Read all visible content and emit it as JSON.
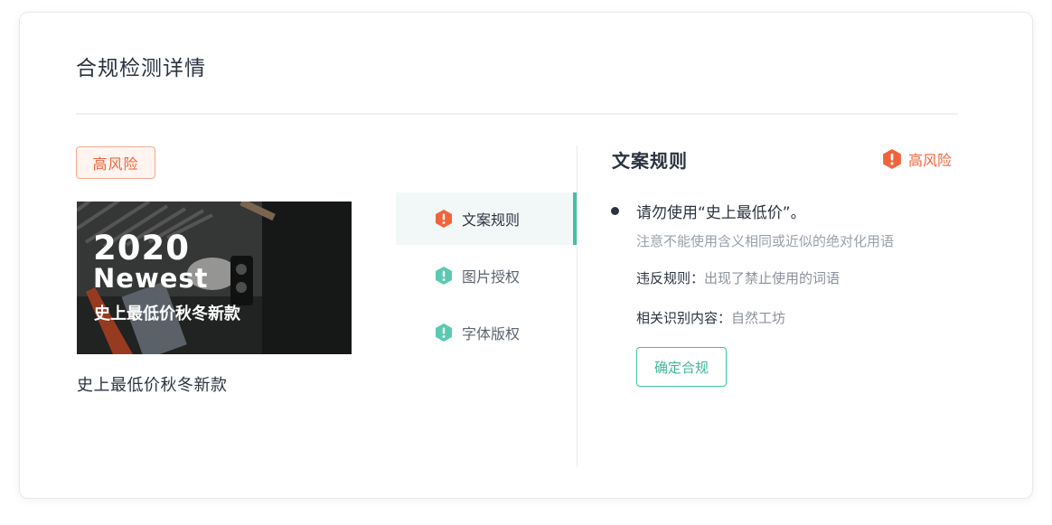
{
  "page": {
    "title": "合规检测详情"
  },
  "left": {
    "risk_tag": "高风险",
    "preview": {
      "year": "2020",
      "word": "Newest",
      "subtitle": "史上最低价秋冬新款"
    },
    "caption": "史上最低价秋冬新款"
  },
  "rules_menu": [
    {
      "label": "文案规则",
      "status": "risk",
      "icon": "warning-hexagon-icon",
      "color": "#f0643c",
      "active": true
    },
    {
      "label": "图片授权",
      "status": "ok",
      "icon": "info-hexagon-icon",
      "color": "#3fc2a6",
      "active": false
    },
    {
      "label": "字体版权",
      "status": "ok",
      "icon": "info-hexagon-icon",
      "color": "#3fc2a6",
      "active": false
    }
  ],
  "detail": {
    "title": "文案规则",
    "risk_label": "高风险",
    "rule_text": "请勿使用“史上最低价”。",
    "rule_note": "注意不能使用含义相同或近似的绝对化用语",
    "violation_key": "违反规则：",
    "violation_value": "出现了禁止使用的词语",
    "related_key": "相关识别内容：",
    "related_value": "自然工坊",
    "confirm_label": "确定合规"
  },
  "colors": {
    "risk": "#f0643c",
    "ok": "#3fc2a6",
    "accent": "#3fc2a6"
  }
}
